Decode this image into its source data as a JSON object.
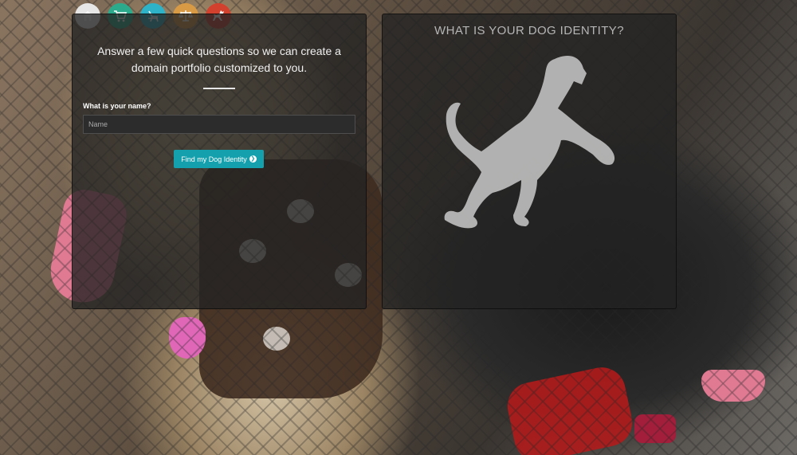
{
  "nav": {
    "items": [
      {
        "name": "home",
        "icon": "home-icon",
        "color": "#e6e6e6"
      },
      {
        "name": "shop",
        "icon": "cart-icon",
        "color": "#2bab8c"
      },
      {
        "name": "pets",
        "icon": "chair-icon",
        "color": "#2db2c8"
      },
      {
        "name": "legal",
        "icon": "scale-icon",
        "color": "#d99a45"
      },
      {
        "name": "dog",
        "icon": "dog-icon",
        "color": "#d2412d"
      }
    ]
  },
  "form": {
    "intro": "Answer a few quick questions so we can create a domain portfolio customized to you.",
    "name_label": "What is your name?",
    "name_placeholder": "Name",
    "name_value": "",
    "submit_label": "Find my Dog Identity"
  },
  "identity": {
    "title": "WHAT IS YOUR DOG IDENTITY?",
    "image_icon": "dog-silhouette-icon"
  },
  "colors": {
    "accent": "#14a1ad",
    "panel": "#232323"
  }
}
